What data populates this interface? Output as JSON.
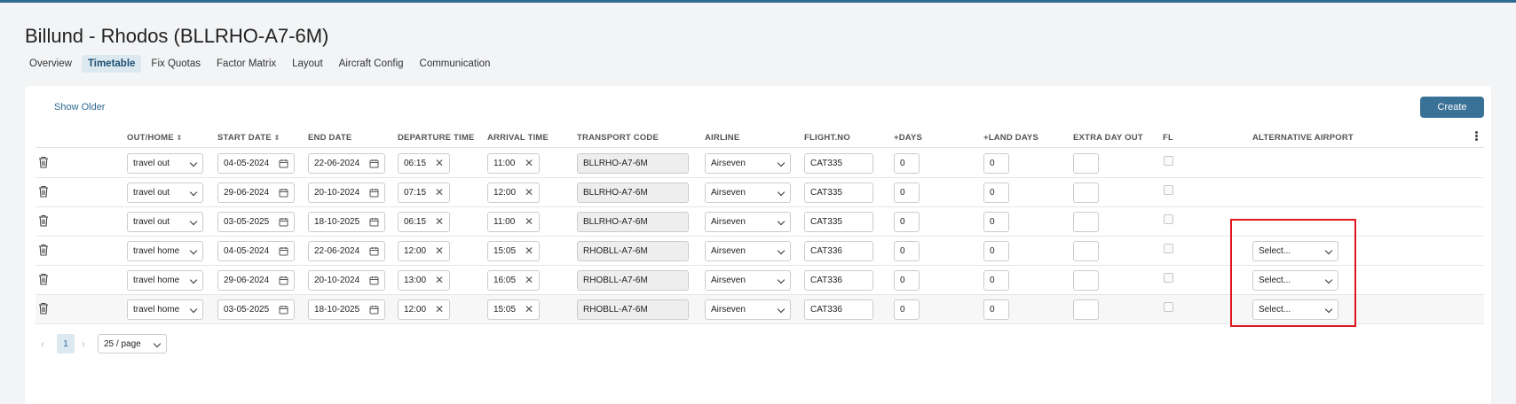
{
  "page": {
    "title": "Billund - Rhodos (BLLRHO-A7-6M)",
    "tabs": [
      {
        "label": "Overview",
        "active": false
      },
      {
        "label": "Timetable",
        "active": true
      },
      {
        "label": "Fix Quotas",
        "active": false
      },
      {
        "label": "Factor Matrix",
        "active": false
      },
      {
        "label": "Layout",
        "active": false
      },
      {
        "label": "Aircraft Config",
        "active": false
      },
      {
        "label": "Communication",
        "active": false
      }
    ]
  },
  "toolbar": {
    "show_older": "Show Older",
    "create": "Create"
  },
  "table": {
    "headers": {
      "out_home": "OUT/HOME",
      "start_date": "START DATE",
      "end_date": "END DATE",
      "departure_time": "DEPARTURE TIME",
      "arrival_time": "ARRIVAL TIME",
      "transport_code": "TRANSPORT CODE",
      "airline": "AIRLINE",
      "flight_no": "FLIGHT.NO",
      "plus_days": "+DAYS",
      "plus_land_days": "+LAND DAYS",
      "extra_day_out": "EXTRA DAY OUT",
      "fl": "FL",
      "alternative_airport": "ALTERNATIVE AIRPORT"
    },
    "rows": [
      {
        "direction": "travel out",
        "start": "04-05-2024",
        "end": "22-06-2024",
        "dep": "06:15",
        "arr": "11:00",
        "code": "BLLRHO-A7-6M",
        "airline": "Airseven",
        "flight": "CAT335",
        "days": "0",
        "land_days": "0",
        "extra": "",
        "alt_airport": null
      },
      {
        "direction": "travel out",
        "start": "29-06-2024",
        "end": "20-10-2024",
        "dep": "07:15",
        "arr": "12:00",
        "code": "BLLRHO-A7-6M",
        "airline": "Airseven",
        "flight": "CAT335",
        "days": "0",
        "land_days": "0",
        "extra": "",
        "alt_airport": null
      },
      {
        "direction": "travel out",
        "start": "03-05-2025",
        "end": "18-10-2025",
        "dep": "06:15",
        "arr": "11:00",
        "code": "BLLRHO-A7-6M",
        "airline": "Airseven",
        "flight": "CAT335",
        "days": "0",
        "land_days": "0",
        "extra": "",
        "alt_airport": null
      },
      {
        "direction": "travel home",
        "start": "04-05-2024",
        "end": "22-06-2024",
        "dep": "12:00",
        "arr": "15:05",
        "code": "RHOBLL-A7-6M",
        "airline": "Airseven",
        "flight": "CAT336",
        "days": "0",
        "land_days": "0",
        "extra": "",
        "alt_airport": "Select..."
      },
      {
        "direction": "travel home",
        "start": "29-06-2024",
        "end": "20-10-2024",
        "dep": "13:00",
        "arr": "16:05",
        "code": "RHOBLL-A7-6M",
        "airline": "Airseven",
        "flight": "CAT336",
        "days": "0",
        "land_days": "0",
        "extra": "",
        "alt_airport": "Select..."
      },
      {
        "direction": "travel home",
        "start": "03-05-2025",
        "end": "18-10-2025",
        "dep": "12:00",
        "arr": "15:05",
        "code": "RHOBLL-A7-6M",
        "airline": "Airseven",
        "flight": "CAT336",
        "days": "0",
        "land_days": "0",
        "extra": "",
        "alt_airport": "Select..."
      }
    ]
  },
  "pagination": {
    "prev": "‹",
    "current": "1",
    "next": "›",
    "page_size": "25 / page"
  },
  "colors": {
    "accent": "#2f6a92",
    "button": "#3a7197",
    "highlight": "#e0161d"
  }
}
